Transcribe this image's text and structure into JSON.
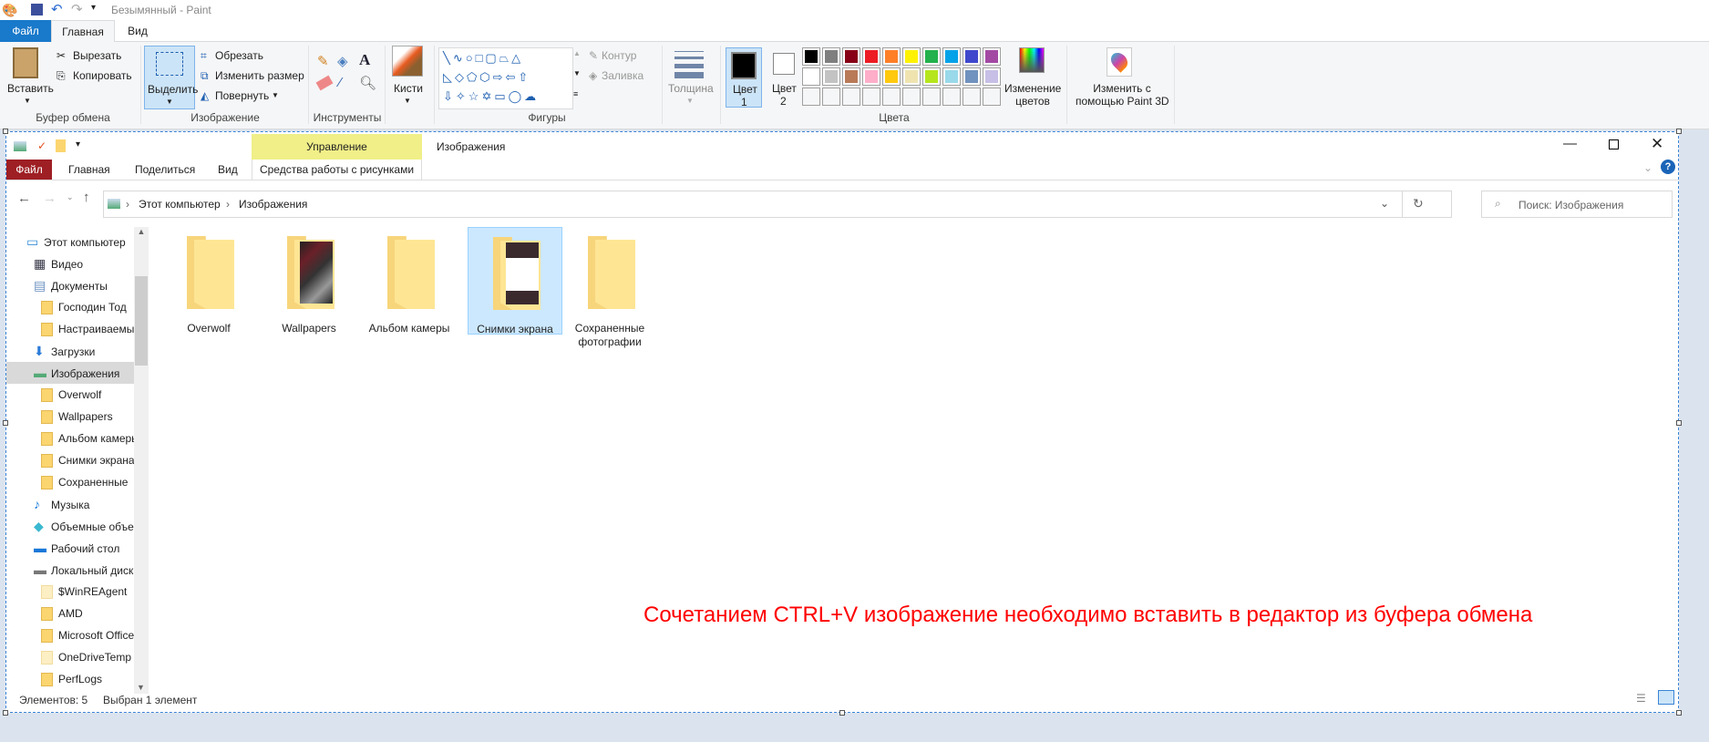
{
  "paint": {
    "title": "Безымянный - Paint",
    "tabs": [
      "Файл",
      "Главная",
      "Вид"
    ],
    "clipboard": {
      "paste": "Вставить",
      "cut": "Вырезать",
      "copy": "Копировать",
      "label": "Буфер обмена"
    },
    "image": {
      "select": "Выделить",
      "crop": "Обрезать",
      "resize": "Изменить размер",
      "rotate": "Повернуть",
      "label": "Изображение"
    },
    "tools": {
      "label": "Инструменты"
    },
    "brushes": "Кисти",
    "shapes": {
      "outline": "Контур",
      "fill": "Заливка",
      "label": "Фигуры"
    },
    "thickness": "Толщина",
    "color1": [
      "Цвет",
      "1"
    ],
    "color2": [
      "Цвет",
      "2"
    ],
    "palette": [
      "#000000",
      "#7f7f7f",
      "#880015",
      "#ed1c24",
      "#ff7f27",
      "#fff200",
      "#22b14c",
      "#00a2e8",
      "#3f48cc",
      "#a349a4",
      "#ffffff",
      "#c3c3c3",
      "#b97a57",
      "#ffaec9",
      "#ffc90e",
      "#efe4b0",
      "#b5e61d",
      "#99d9ea",
      "#7092be",
      "#c8bfe7"
    ],
    "edit_colors": [
      "Изменение",
      "цветов"
    ],
    "paint3d": [
      "Изменить с",
      "помощью Paint 3D"
    ],
    "colors_label": "Цвета"
  },
  "explorer": {
    "title": "Изображения",
    "manage": "Управление",
    "tabs": [
      "Файл",
      "Главная",
      "Поделиться",
      "Вид"
    ],
    "context_tab": "Средства работы с рисунками",
    "breadcrumb": [
      "Этот компьютер",
      "Изображения"
    ],
    "search_placeholder": "Поиск: Изображения",
    "nav": [
      {
        "label": "Этот компьютер",
        "icon": "pc",
        "lvl": 0
      },
      {
        "label": "Видео",
        "icon": "video",
        "lvl": 1
      },
      {
        "label": "Документы",
        "icon": "doc",
        "lvl": 1
      },
      {
        "label": "Господин Тод",
        "icon": "folder",
        "lvl": 2
      },
      {
        "label": "Настраиваемые",
        "icon": "folder",
        "lvl": 2
      },
      {
        "label": "Загрузки",
        "icon": "down",
        "lvl": 1
      },
      {
        "label": "Изображения",
        "icon": "pic",
        "lvl": 1,
        "selected": true
      },
      {
        "label": "Overwolf",
        "icon": "folder",
        "lvl": 2
      },
      {
        "label": "Wallpapers",
        "icon": "folder",
        "lvl": 2
      },
      {
        "label": "Альбом камеры",
        "icon": "folder",
        "lvl": 2
      },
      {
        "label": "Снимки экрана",
        "icon": "folder",
        "lvl": 2
      },
      {
        "label": "Сохраненные",
        "icon": "folder",
        "lvl": 2
      },
      {
        "label": "Музыка",
        "icon": "music",
        "lvl": 1
      },
      {
        "label": "Объемные объекты",
        "icon": "3d",
        "lvl": 1
      },
      {
        "label": "Рабочий стол",
        "icon": "desk",
        "lvl": 1
      },
      {
        "label": "Локальный диск",
        "icon": "disk",
        "lvl": 1
      },
      {
        "label": "$WinREAgent",
        "icon": "folder-light",
        "lvl": 2
      },
      {
        "label": "AMD",
        "icon": "folder",
        "lvl": 2
      },
      {
        "label": "Microsoft Office",
        "icon": "folder",
        "lvl": 2
      },
      {
        "label": "OneDriveTemp",
        "icon": "folder-light",
        "lvl": 2
      },
      {
        "label": "PerfLogs",
        "icon": "folder",
        "lvl": 2
      }
    ],
    "items": [
      {
        "label": "Overwolf"
      },
      {
        "label": "Wallpapers",
        "thumb": true
      },
      {
        "label": "Альбом камеры"
      },
      {
        "label": "Снимки экрана",
        "thumb": true,
        "selected": true
      },
      {
        "label": "Сохраненные фотографии"
      }
    ],
    "status": {
      "count": "Элементов: 5",
      "selected": "Выбран 1 элемент"
    }
  },
  "note": "Сочетанием CTRL+V изображение необходимо вставить в редактор из буфера обмена"
}
